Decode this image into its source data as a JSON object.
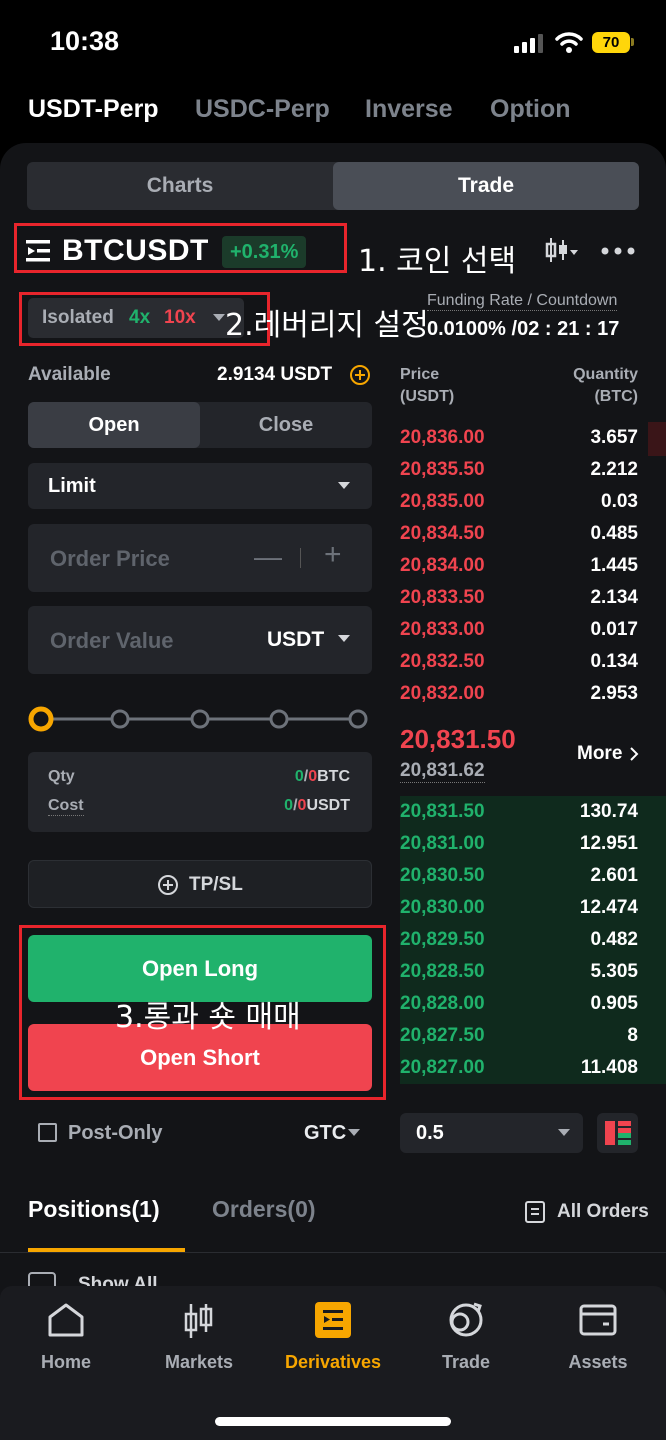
{
  "status": {
    "time": "10:38",
    "battery": "70"
  },
  "top_tabs": [
    "USDT-Perp",
    "USDC-Perp",
    "Inverse",
    "Option"
  ],
  "view_tabs": {
    "charts": "Charts",
    "trade": "Trade"
  },
  "symbol": {
    "name": "BTCUSDT",
    "change": "+0.31%"
  },
  "annotations": {
    "a1": "1. 코인 선택",
    "a2": "2.레버리지 설정",
    "a3": "3.롱과 숏 매매"
  },
  "leverage": {
    "mode": "Isolated",
    "long": "4x",
    "short": "10x"
  },
  "funding": {
    "label": "Funding Rate / Countdown",
    "value": "0.0100% /02 : 21 : 17"
  },
  "available": {
    "label": "Available",
    "value": "2.9134 USDT"
  },
  "order_tabs": {
    "open": "Open",
    "close": "Close"
  },
  "order_type": "Limit",
  "order_price": {
    "placeholder": "Order Price",
    "minus": "—",
    "plus": "+"
  },
  "order_value": {
    "placeholder": "Order Value",
    "unit": "USDT"
  },
  "slider": {
    "value": 0
  },
  "summary": {
    "qty_label": "Qty",
    "qty_a": "0",
    "qty_b": "0",
    "qty_unit": "BTC",
    "cost_label": "Cost",
    "cost_a": "0",
    "cost_b": "0",
    "cost_unit": "USDT"
  },
  "tpsl": "TP/SL",
  "buttons": {
    "long": "Open Long",
    "short": "Open Short"
  },
  "post_only": "Post-Only",
  "tif": "GTC",
  "depth_select": "0.5",
  "orderbook": {
    "price_header": [
      "Price",
      "(USDT)"
    ],
    "qty_header": [
      "Quantity",
      "(BTC)"
    ],
    "asks": [
      {
        "price": "20,836.00",
        "qty": "3.657"
      },
      {
        "price": "20,835.50",
        "qty": "2.212"
      },
      {
        "price": "20,835.00",
        "qty": "0.03"
      },
      {
        "price": "20,834.50",
        "qty": "0.485"
      },
      {
        "price": "20,834.00",
        "qty": "1.445"
      },
      {
        "price": "20,833.50",
        "qty": "2.134"
      },
      {
        "price": "20,833.00",
        "qty": "0.017"
      },
      {
        "price": "20,832.50",
        "qty": "0.134"
      },
      {
        "price": "20,832.00",
        "qty": "2.953"
      }
    ],
    "last_price": "20,831.50",
    "mark_price": "20,831.62",
    "more": "More",
    "bids": [
      {
        "price": "20,831.50",
        "qty": "130.74"
      },
      {
        "price": "20,831.00",
        "qty": "12.951"
      },
      {
        "price": "20,830.50",
        "qty": "2.601"
      },
      {
        "price": "20,830.00",
        "qty": "12.474"
      },
      {
        "price": "20,829.50",
        "qty": "0.482"
      },
      {
        "price": "20,828.50",
        "qty": "5.305"
      },
      {
        "price": "20,828.00",
        "qty": "0.905"
      },
      {
        "price": "20,827.50",
        "qty": "8"
      },
      {
        "price": "20,827.00",
        "qty": "11.408"
      }
    ]
  },
  "bottom_tabs": {
    "positions": "Positions(1)",
    "orders": "Orders(0)",
    "all_orders": "All Orders"
  },
  "show_all": "Show All",
  "nav": [
    "Home",
    "Markets",
    "Derivatives",
    "Trade",
    "Assets"
  ],
  "colors": {
    "green": "#20b26c",
    "red": "#f0444f",
    "accent": "#f7a600"
  }
}
